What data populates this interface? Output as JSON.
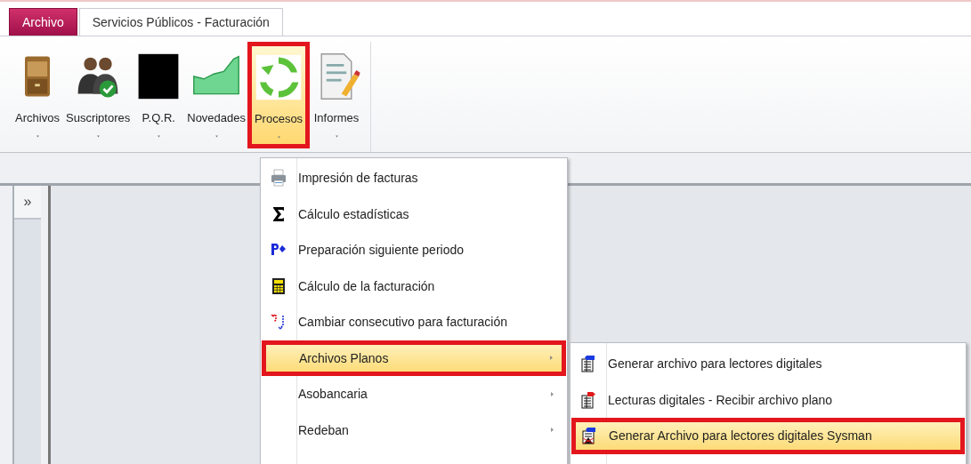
{
  "app_tabs": [
    {
      "label": "Archivo",
      "kind": "file"
    },
    {
      "label": "Servicios Públicos - Facturación",
      "kind": "tab",
      "selected": true
    }
  ],
  "ribbon": {
    "buttons": [
      {
        "label": "Archivos",
        "kind": "cabinet",
        "selected": false,
        "annotated": false
      },
      {
        "label": "Suscriptores",
        "kind": "users",
        "selected": false,
        "annotated": false
      },
      {
        "label": "P.Q.R.",
        "kind": "black",
        "selected": false,
        "annotated": false
      },
      {
        "label": "Novedades",
        "kind": "chart",
        "selected": false,
        "annotated": false
      },
      {
        "label": "Procesos",
        "kind": "recycle",
        "selected": true,
        "annotated": true
      },
      {
        "label": "Informes",
        "kind": "report",
        "selected": false,
        "annotated": false
      }
    ]
  },
  "side_panel": {
    "toggle": "»"
  },
  "menu": {
    "items": [
      {
        "label": "Impresión de facturas",
        "kind": "printer",
        "submenu": false,
        "selected": false,
        "annotated": false
      },
      {
        "label": "Cálculo estadísticas",
        "kind": "sigma",
        "submenu": false,
        "selected": false,
        "annotated": false
      },
      {
        "label": "Preparación siguiente periodo",
        "kind": "next",
        "submenu": false,
        "selected": false,
        "annotated": false
      },
      {
        "label": "Cálculo de la facturación",
        "kind": "calculator",
        "submenu": false,
        "selected": false,
        "annotated": false
      },
      {
        "label": "Cambiar consecutivo para facturación",
        "kind": "swap",
        "submenu": false,
        "selected": false,
        "annotated": false
      },
      {
        "label": "Archivos Planos",
        "kind": "none",
        "submenu": true,
        "selected": true,
        "annotated": true
      },
      {
        "label": "Asobancaria",
        "kind": "none",
        "submenu": true,
        "selected": false,
        "annotated": false
      },
      {
        "label": "Redeban",
        "kind": "none",
        "submenu": true,
        "selected": false,
        "annotated": false
      }
    ]
  },
  "submenu": {
    "items": [
      {
        "label": "Generar archivo para lectores digitales",
        "kind": "export",
        "selected": false,
        "annotated": false
      },
      {
        "label": "Lecturas digitales - Recibir archivo plano",
        "kind": "import",
        "selected": false,
        "annotated": false
      },
      {
        "label": "Generar Archivo para lectores digitales Sysman",
        "kind": "export-x",
        "selected": true,
        "annotated": true
      }
    ]
  }
}
